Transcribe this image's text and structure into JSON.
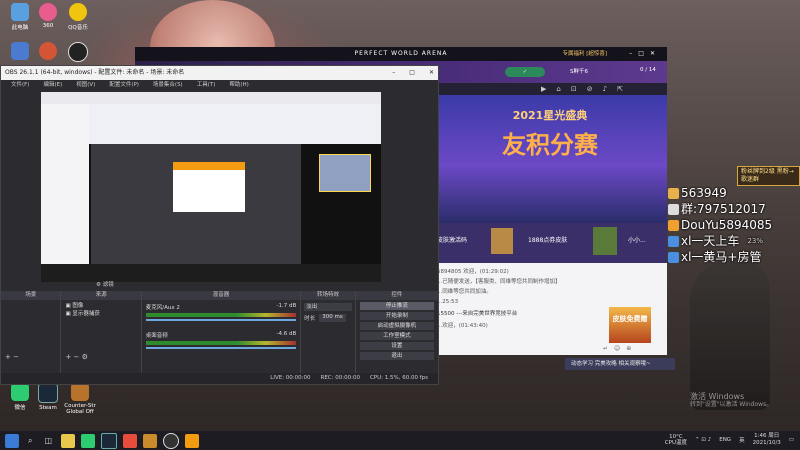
{
  "desktop": {
    "icons": [
      {
        "label": "此电脑",
        "color": "#5aa0e0"
      },
      {
        "label": "360",
        "color": "#e85d8e"
      },
      {
        "label": "QQ音乐",
        "color": "#f1c40f"
      },
      {
        "label": "",
        "color": "#4a7bd1"
      },
      {
        "label": "",
        "color": "#d25535"
      },
      {
        "label": "",
        "color": "#222222"
      }
    ],
    "bottom_icons": [
      {
        "label": "微信",
        "color": "#2ecc71"
      },
      {
        "label": "Steam",
        "color": "#1b2838"
      },
      {
        "label": "Counter-Str Global Off",
        "color": "#b7732c"
      }
    ]
  },
  "obs": {
    "title": "OBS 26.1.1 (64-bit, windows) - 配置文件: 未命名 - 场景: 未命名",
    "menu": [
      "文件(F)",
      "编辑(E)",
      "视图(V)",
      "配置文件(P)",
      "场景集合(S)",
      "工具(T)",
      "帮助(H)"
    ],
    "panels": {
      "scenes": "场景",
      "sources": "来源",
      "mixer": "混音器",
      "transitions": "转场特效",
      "controls": "控件"
    },
    "sources_list": [
      "图像",
      "显示器捕获"
    ],
    "mixer_tracks": [
      {
        "name": "麦克风/Aux 2",
        "db": "-1.7 dB"
      },
      {
        "name": "桌面音频",
        "db": "-4.6 dB"
      }
    ],
    "transition": {
      "name": "淡出",
      "duration_label": "时长",
      "duration": "300 ms"
    },
    "controls": [
      "停止推流",
      "开始录制",
      "启动虚拟摄像机",
      "工作室模式",
      "设置",
      "退出"
    ],
    "filter_label": "滤镜",
    "status": [
      "LIVE: 00:00:00",
      "REC: 00:00:00",
      "CPU: 1.5%, 60.00 fps"
    ]
  },
  "arena": {
    "title": "PERFECT WORLD ARENA",
    "top_badge": "专属福利 [超惊喜]",
    "user_tag": "S鲜千6",
    "counter": "0 / 14",
    "banner_year": "2021星光盛典",
    "banner_title": "友积分赛",
    "gifts": [
      "皮肤激活码",
      "1888点券皮肤",
      "小小..."
    ],
    "chat_lines": [
      "5894805 欢迎，(01:29:02)",
      "...已随便发送，【客服类、同维等您共同制作增加】",
      "...同维等您共同加油。",
      "...25:53",
      "15500  ---来自完美世界竞技平台",
      "...欢迎，(01:43:40)"
    ],
    "skin_badge": "皮肤免费赠",
    "promo": "动态学习 完美攻略 相关观察哦~"
  },
  "overlay": {
    "fan_badge": "粉丝牌到2级 黑粉→歌迷群",
    "lines": [
      {
        "text": "563949",
        "color": "#e8b04c"
      },
      {
        "text": "群:797512017",
        "color": "#dddddd"
      },
      {
        "text": "DouYu5894085",
        "color": "#f0a030"
      },
      {
        "text": "xl一天上车",
        "color": "#4a90e2"
      },
      {
        "text": "xl一黄马+房管",
        "color": "#4a90e2"
      }
    ],
    "percent": "23%"
  },
  "watermark": {
    "line1": "激活 Windows",
    "line2": "转到\"设置\"以激活 Windows。"
  },
  "taskbar": {
    "weather": "10°C",
    "weather_sub": "CPU温度",
    "lang": "ENG",
    "ime": "英",
    "time": "1:46 周日",
    "date": "2021/10/3"
  }
}
